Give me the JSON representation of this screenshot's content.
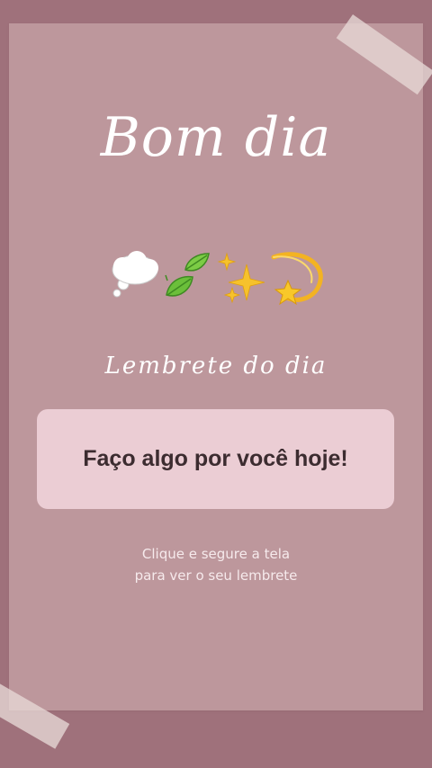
{
  "colors": {
    "page_background": "#9f717b",
    "card_background": "#bd979c",
    "reminder_box": "#ebcdd4",
    "tape": "#e7d8d6",
    "title_text": "#ffffff",
    "reminder_text": "#3c2c30"
  },
  "greeting": {
    "title": "Bom dia",
    "emojis": [
      "thought-cloud-icon",
      "leaves-icon",
      "sparkles-icon",
      "dizzy-star-icon"
    ]
  },
  "reminder": {
    "heading": "Lembrete do dia",
    "text": "Faço algo por você hoje!",
    "hint_line1": "Clique e segure a tela",
    "hint_line2": "para ver o seu lembrete"
  }
}
